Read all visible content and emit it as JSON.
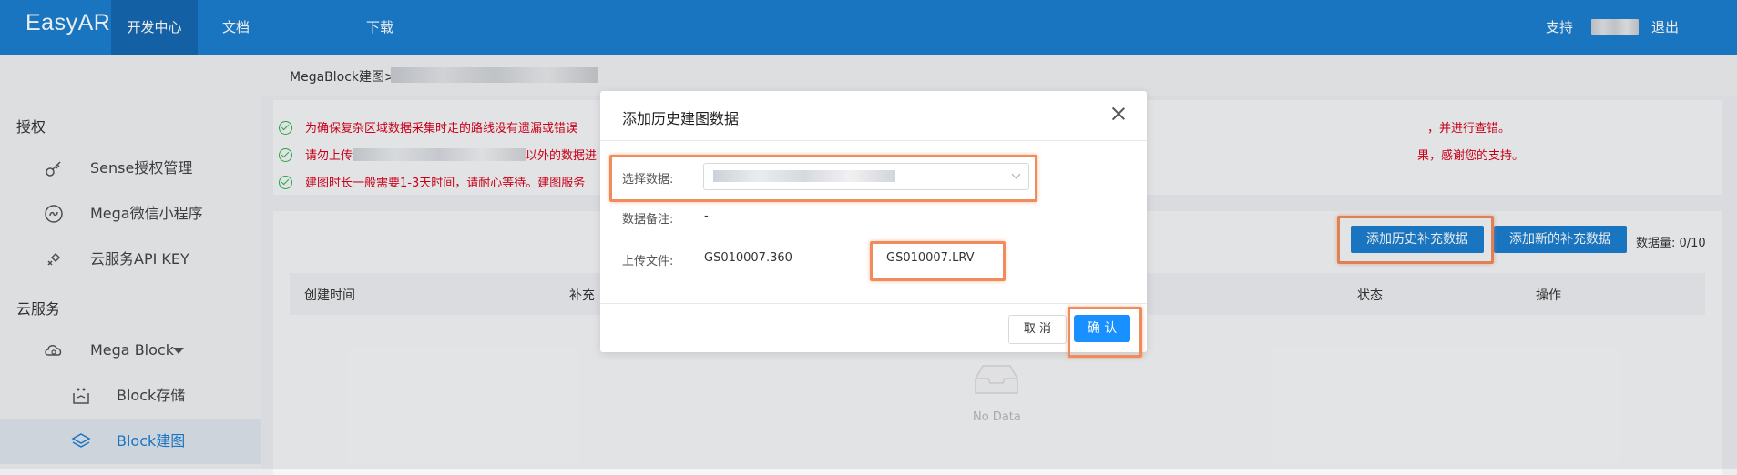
{
  "nav": {
    "logo": "EasyAR",
    "items": [
      "开发中心",
      "文档",
      "下载"
    ],
    "support": "支持",
    "logout": "退出"
  },
  "sidebar": {
    "group_auth": "授权",
    "sense": "Sense授权管理",
    "mega_wechat": "Mega微信小程序",
    "api_key": "云服务API KEY",
    "group_cloud": "云服务",
    "mega_block": "Mega Block",
    "block_storage": "Block存储",
    "block_mapping": "Block建图"
  },
  "breadcrumb": "MegaBlock建图>",
  "notices": {
    "n1_start": "为确保复杂区域数据采集时走的路线没有遗漏或错误",
    "n1_end": "，并进行查错。",
    "n2_start": "请勿上传",
    "n2_mid": "以外的数据进",
    "n2_end": "果，感谢您的支持。",
    "n3": "建图时长一般需要1-3天时间，请耐心等待。建图服务"
  },
  "panel": {
    "add_history_btn": "添加历史补充数据",
    "add_new_btn": "添加新的补充数据",
    "count": "数据量: 0/10",
    "col_created": "创建时间",
    "col_supplement": "补充",
    "col_status": "状态",
    "col_action": "操作",
    "no_data": "No Data"
  },
  "modal": {
    "title": "添加历史建图数据",
    "select_label": "选择数据:",
    "remark_label": "数据备注:",
    "remark_value": "-",
    "upload_label": "上传文件:",
    "file1": "GS010007.360",
    "file2": "GS010007.LRV",
    "cancel": "取 消",
    "confirm": "确 认"
  },
  "colors": {
    "brand": "#1d7fd1",
    "highlight": "#f08c5c",
    "warning_text": "#d9001b"
  }
}
